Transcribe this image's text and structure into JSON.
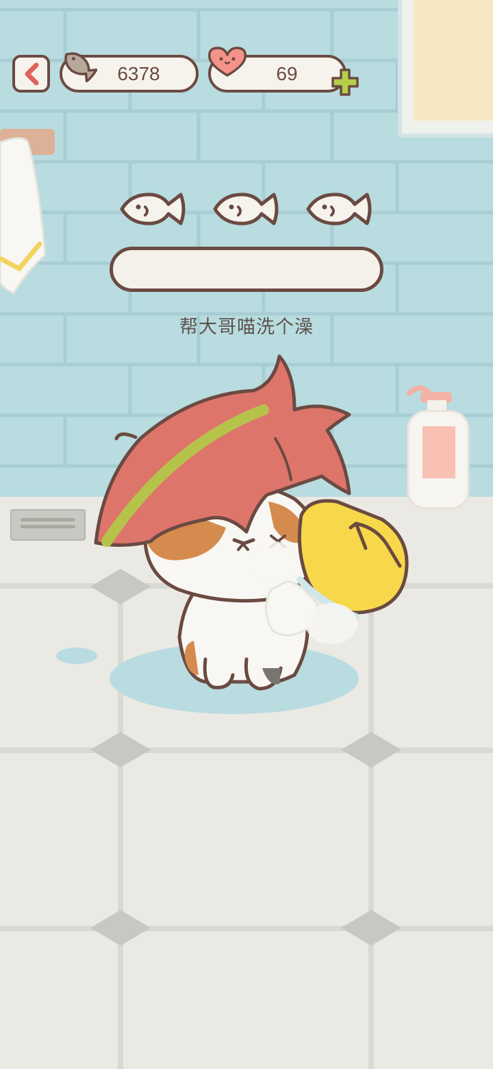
{
  "hud": {
    "back_label": "back",
    "fish_count": "6378",
    "heart_count": "69"
  },
  "task": {
    "goal_fish_total": 3,
    "goal_fish_earned": 0,
    "progress": 0,
    "instruction": "帮大哥喵洗个澡"
  },
  "icons": {
    "back": "chevron-left-icon",
    "currency": "fish-icon",
    "affection": "heart-icon",
    "add": "plus-icon",
    "tool": "shower-brush-icon"
  },
  "colors": {
    "outline": "#6b4a42",
    "wall": "#b8dce0",
    "floor": "#ebe9e4",
    "accent_red": "#e0625c",
    "plus_green": "#b5cf4a",
    "brush_yellow": "#f7d84a",
    "cat_hair": "#de756b"
  }
}
